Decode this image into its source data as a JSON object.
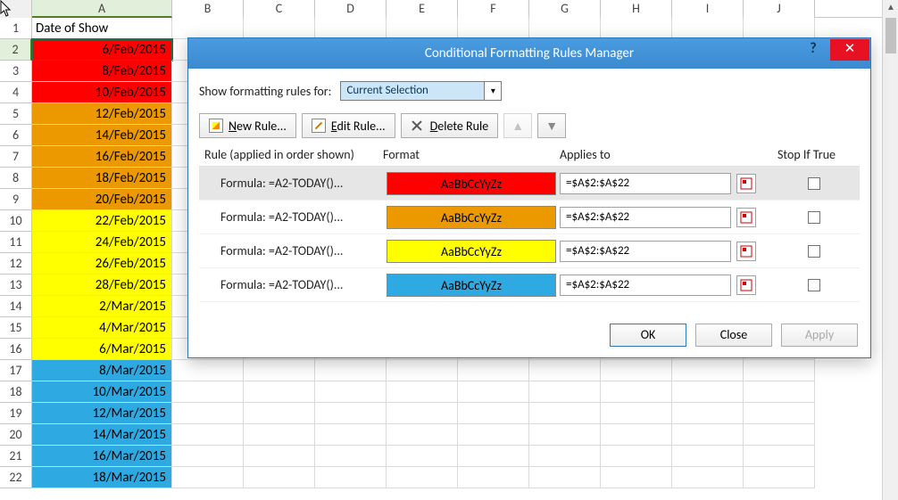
{
  "spreadsheet": {
    "columns": [
      "A",
      "B",
      "C",
      "D",
      "E",
      "F",
      "G",
      "H",
      "I",
      "J"
    ],
    "header_cell": "Date of Show",
    "selected_cell": "A2",
    "rows": [
      {
        "n": 1,
        "value": "Date of Show",
        "color": null
      },
      {
        "n": 2,
        "value": "6/Feb/2015",
        "color": "red"
      },
      {
        "n": 3,
        "value": "8/Feb/2015",
        "color": "red"
      },
      {
        "n": 4,
        "value": "10/Feb/2015",
        "color": "red"
      },
      {
        "n": 5,
        "value": "12/Feb/2015",
        "color": "orange"
      },
      {
        "n": 6,
        "value": "14/Feb/2015",
        "color": "orange"
      },
      {
        "n": 7,
        "value": "16/Feb/2015",
        "color": "orange"
      },
      {
        "n": 8,
        "value": "18/Feb/2015",
        "color": "orange"
      },
      {
        "n": 9,
        "value": "20/Feb/2015",
        "color": "orange"
      },
      {
        "n": 10,
        "value": "22/Feb/2015",
        "color": "yellow"
      },
      {
        "n": 11,
        "value": "24/Feb/2015",
        "color": "yellow"
      },
      {
        "n": 12,
        "value": "26/Feb/2015",
        "color": "yellow"
      },
      {
        "n": 13,
        "value": "28/Feb/2015",
        "color": "yellow"
      },
      {
        "n": 14,
        "value": "2/Mar/2015",
        "color": "yellow"
      },
      {
        "n": 15,
        "value": "4/Mar/2015",
        "color": "yellow"
      },
      {
        "n": 16,
        "value": "6/Mar/2015",
        "color": "yellow"
      },
      {
        "n": 17,
        "value": "8/Mar/2015",
        "color": "blue"
      },
      {
        "n": 18,
        "value": "10/Mar/2015",
        "color": "blue"
      },
      {
        "n": 19,
        "value": "12/Mar/2015",
        "color": "blue"
      },
      {
        "n": 20,
        "value": "14/Mar/2015",
        "color": "blue"
      },
      {
        "n": 21,
        "value": "16/Mar/2015",
        "color": "blue"
      },
      {
        "n": 22,
        "value": "18/Mar/2015",
        "color": "blue"
      }
    ]
  },
  "dialog": {
    "title": "Conditional Formatting Rules Manager",
    "show_for_label": "Show formatting rules for:",
    "show_for_value": "Current Selection",
    "toolbar": {
      "new_rule": "New Rule...",
      "edit_rule": "Edit Rule...",
      "delete_rule": "Delete Rule"
    },
    "col_headers": {
      "rule": "Rule (applied in order shown)",
      "format": "Format",
      "applies": "Applies to",
      "stop": "Stop If True"
    },
    "format_sample": "AaBbCcYyZz",
    "rules": [
      {
        "formula": "Formula: =A2-TODAY()...",
        "preview_bg": "#ff0000",
        "applies_to": "=$A$2:$A$22",
        "stop": false,
        "selected": true
      },
      {
        "formula": "Formula: =A2-TODAY()...",
        "preview_bg": "#ec9900",
        "applies_to": "=$A$2:$A$22",
        "stop": false,
        "selected": false
      },
      {
        "formula": "Formula: =A2-TODAY()...",
        "preview_bg": "#ffff00",
        "applies_to": "=$A$2:$A$22",
        "stop": false,
        "selected": false
      },
      {
        "formula": "Formula: =A2-TODAY()...",
        "preview_bg": "#2ea9e1",
        "applies_to": "=$A$2:$A$22",
        "stop": false,
        "selected": false
      }
    ],
    "footer": {
      "ok": "OK",
      "close": "Close",
      "apply": "Apply"
    }
  }
}
